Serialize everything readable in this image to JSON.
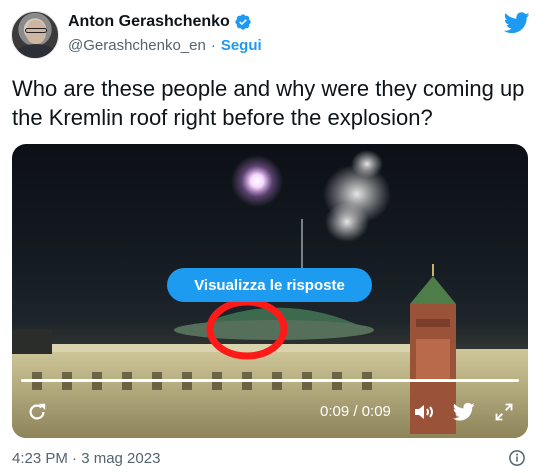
{
  "author": {
    "display_name": "Anton Gerashchenko",
    "handle": "@Gerashchenko_en",
    "separator": "·",
    "follow_label": "Segui"
  },
  "tweet": {
    "text": "Who are these people and why were they coming up the Kremlin roof right before the explosion?"
  },
  "media": {
    "overlay_button_label": "Visualizza le risposte",
    "time_display": "0:09 / 0:09",
    "progress_fraction": 1.0
  },
  "footer": {
    "timestamp": "4:23 PM · 3 mag 2023"
  },
  "colors": {
    "accent": "#1d9bf0",
    "text": "#0f1419",
    "secondary": "#536471",
    "highlight_circle": "#ff1a1a"
  },
  "icons": [
    "verified-badge-icon",
    "twitter-bird-icon",
    "replay-icon",
    "volume-icon",
    "twitter-small-icon",
    "fullscreen-icon",
    "info-icon"
  ]
}
